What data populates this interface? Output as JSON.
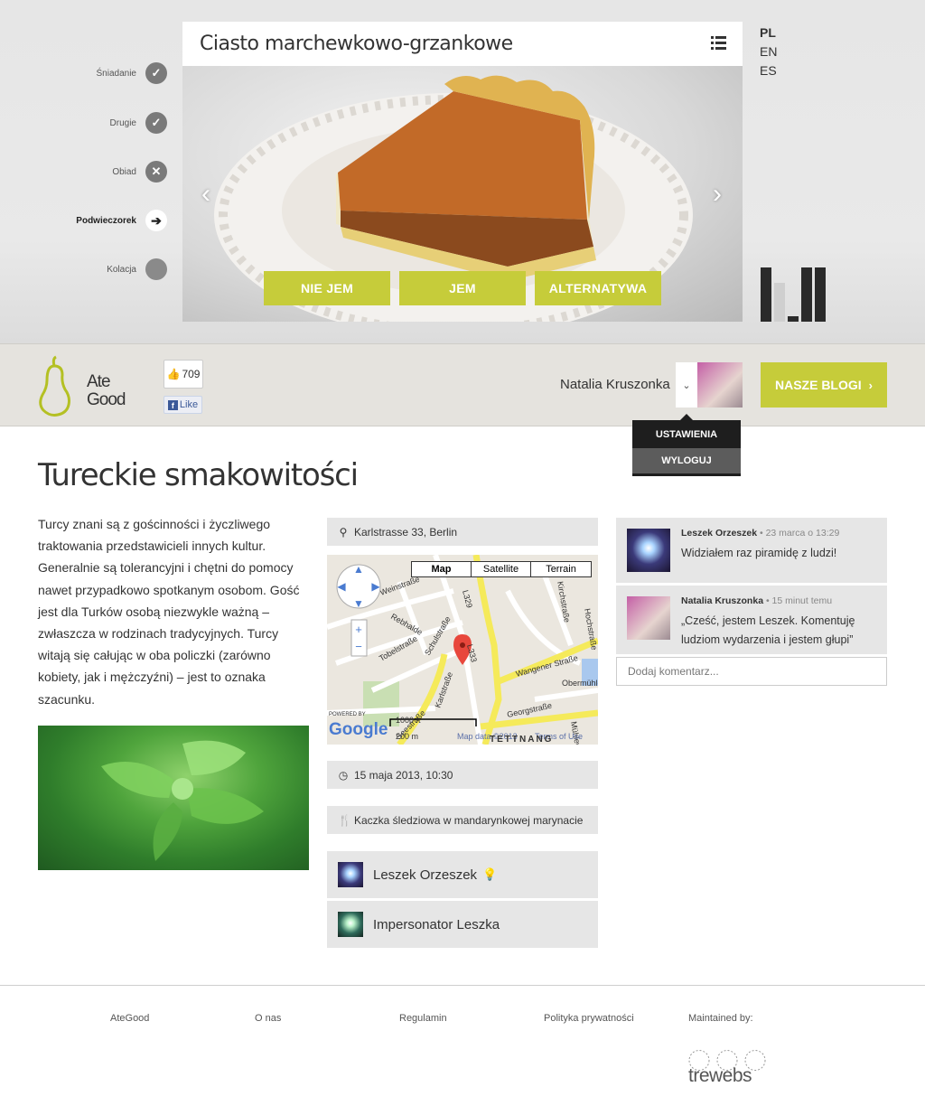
{
  "meals": [
    {
      "label": "Śniadanie",
      "state": "done"
    },
    {
      "label": "Drugie",
      "state": "done"
    },
    {
      "label": "Obiad",
      "state": "skipped"
    },
    {
      "label": "Podwieczorek",
      "state": "current"
    },
    {
      "label": "Kolacja",
      "state": "pending"
    }
  ],
  "slider": {
    "title": "Ciasto marchewkowo-grzankowe",
    "buttons": {
      "no": "NIE JEM",
      "yes": "JEM",
      "alt": "ALTERNATYWA"
    },
    "prev": "‹",
    "next": "›"
  },
  "languages": [
    "PL",
    "EN",
    "ES"
  ],
  "activeLanguage": "PL",
  "header": {
    "logo_line1": "Ate",
    "logo_line2": "Good",
    "like_count": "709",
    "like_label": "Like",
    "user_name": "Natalia Kruszonka",
    "blog_button": "NASZE BLOGI"
  },
  "user_menu": {
    "settings": "USTAWIENIA",
    "logout": "WYLOGUJ"
  },
  "main": {
    "title": "Tureckie smakowitości",
    "description": "Turcy znani są z gościnności i życzliwego traktowania przedstawicieli innych kultur. Generalnie są tolerancyjni i chętni do pomocy nawet przypadkowo spotkanym osobom. Gość jest dla Turków osobą niezwykle ważną – zwłaszcza w rodzinach tradycyjnych. Turcy witają się całując w oba policzki (zarówno kobiety, jak i mężczyźni) – jest to oznaka szacunku."
  },
  "event": {
    "address": "Karlstrasse 33, Berlin",
    "date": "15 maja 2013, 10:30",
    "dish": "Kaczka śledziowa w mandarynkowej marynacie",
    "people": [
      {
        "name": "Leszek Orzeszek",
        "host": true
      },
      {
        "name": "Impersonator Leszka",
        "host": false
      }
    ]
  },
  "map": {
    "types": [
      "Map",
      "Satellite",
      "Terrain"
    ],
    "selected": "Map",
    "streets": [
      "Weinstraße",
      "Rebhalde",
      "Tobelstraße",
      "Schulstraße",
      "Karlstraße",
      "L329",
      "Wangener Straße",
      "Georgstraße",
      "Hochstraße",
      "Obermühle",
      "Mühlewe",
      "Seestraße",
      "Kirchstraße",
      "L333"
    ],
    "scale_top": "1000 ft",
    "scale_bottom": "200 m",
    "powered": "POWERED BY",
    "google": "Google",
    "attribution": "Map data ©2013",
    "terms": "Terms of Use",
    "place": "TETTNANG"
  },
  "comments": [
    {
      "author": "Leszek Orzeszek",
      "time": "• 23 marca o 13:29",
      "text": "Widziałem raz piramidę z ludzi!"
    },
    {
      "author": "Natalia Kruszonka",
      "time": "• 15 minut temu",
      "text": "„Cześć, jestem Leszek. Komentuję ludziom wydarzenia i jestem głupi”"
    }
  ],
  "comment_placeholder": "Dodaj komentarz...",
  "footer": {
    "links": [
      "AteGood",
      "O nas",
      "Regulamin",
      "Polityka prywatności"
    ],
    "maintained": "Maintained by:",
    "company": "trewebs"
  },
  "colors": {
    "accent": "#c6cc3a",
    "dark": "#1e1e1e",
    "panel": "#e6e6e6"
  },
  "progress_bars": [
    1.0,
    0.72,
    0.1,
    1.0,
    1.0
  ]
}
